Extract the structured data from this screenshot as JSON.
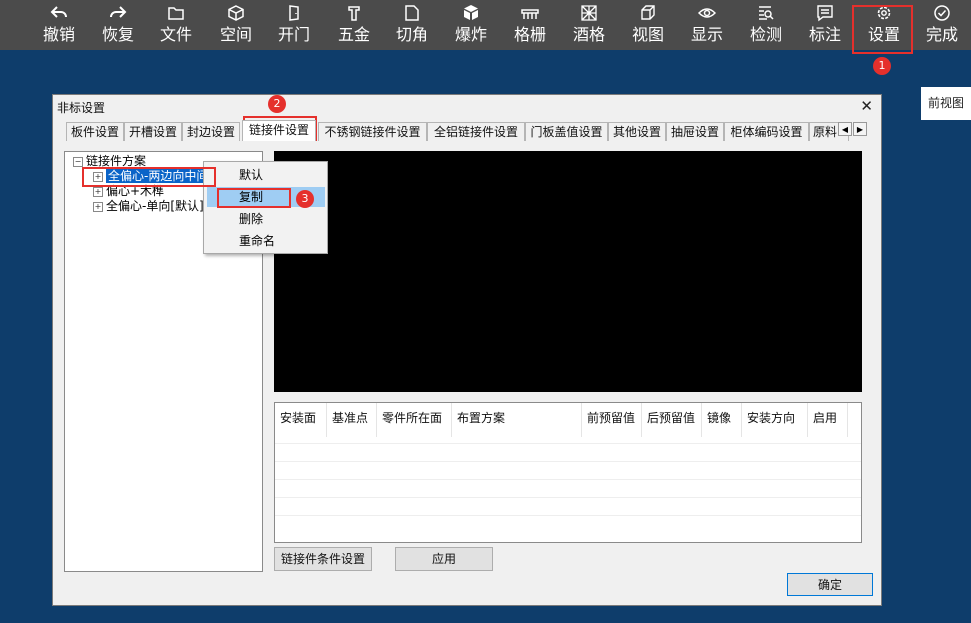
{
  "toolbar": {
    "items": [
      {
        "label": "撤销",
        "icon": "undo-icon"
      },
      {
        "label": "恢复",
        "icon": "redo-icon"
      },
      {
        "label": "文件",
        "icon": "folder-icon"
      },
      {
        "label": "空间",
        "icon": "cube-icon"
      },
      {
        "label": "开门",
        "icon": "door-icon"
      },
      {
        "label": "五金",
        "icon": "hardware-icon"
      },
      {
        "label": "切角",
        "icon": "chamfer-icon"
      },
      {
        "label": "爆炸",
        "icon": "explode-icon"
      },
      {
        "label": "格栅",
        "icon": "grille-icon"
      },
      {
        "label": "酒格",
        "icon": "wine-rack-icon"
      },
      {
        "label": "视图",
        "icon": "view-icon"
      },
      {
        "label": "显示",
        "icon": "eye-icon"
      },
      {
        "label": "检测",
        "icon": "inspect-icon"
      },
      {
        "label": "标注",
        "icon": "annotation-icon"
      },
      {
        "label": "设置",
        "icon": "gear-icon"
      },
      {
        "label": "完成",
        "icon": "check-circle-icon"
      }
    ]
  },
  "annotations": {
    "step1": "1",
    "step2": "2",
    "step3": "3",
    "accent": "#e5302c"
  },
  "side_panel": {
    "label": "前视图"
  },
  "dialog": {
    "title": "非标设置",
    "close": "✕",
    "tabs": [
      "板件设置",
      "开槽设置",
      "封边设置",
      "链接件设置",
      "不锈钢链接件设置",
      "全铝链接件设置",
      "门板盖值设置",
      "其他设置",
      "抽屉设置",
      "柜体编码设置",
      "原料"
    ],
    "active_tab": "链接件设置",
    "tree": {
      "root": "链接件方案",
      "items": [
        "全偏心-两边向中间",
        "偏心+木榫",
        "全偏心-单向[默认]"
      ]
    },
    "context_menu": {
      "items": [
        "默认",
        "复制",
        "删除",
        "重命名"
      ],
      "hovered": "复制"
    },
    "table": {
      "headers": [
        "安装面",
        "基准点",
        "零件所在面",
        "布置方案",
        "前预留值",
        "后预留值",
        "镜像",
        "安装方向",
        "启用"
      ],
      "rows": []
    },
    "buttons": {
      "conditions": "链接件条件设置",
      "apply": "应用",
      "ok": "确定"
    }
  }
}
